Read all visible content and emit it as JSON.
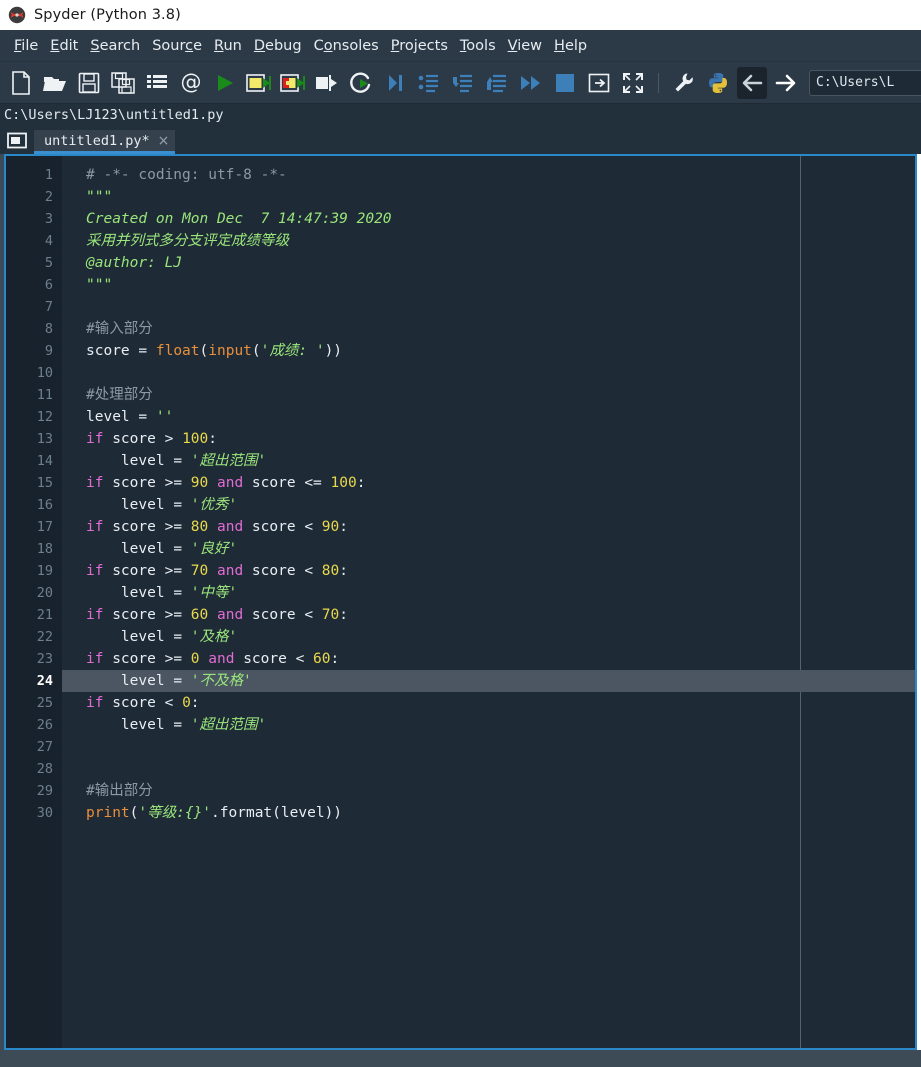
{
  "window": {
    "title": "Spyder (Python 3.8)",
    "app_icon": "spyder-logo-icon"
  },
  "menubar": {
    "items": [
      {
        "label": "File",
        "accel": "F"
      },
      {
        "label": "Edit",
        "accel": "E"
      },
      {
        "label": "Search",
        "accel": "S"
      },
      {
        "label": "Source",
        "accel": "c"
      },
      {
        "label": "Run",
        "accel": "R"
      },
      {
        "label": "Debug",
        "accel": "D"
      },
      {
        "label": "Consoles",
        "accel": "o"
      },
      {
        "label": "Projects",
        "accel": "P"
      },
      {
        "label": "Tools",
        "accel": "T"
      },
      {
        "label": "View",
        "accel": "V"
      },
      {
        "label": "Help",
        "accel": "H"
      }
    ]
  },
  "toolbar": {
    "buttons": [
      {
        "name": "new-file-icon",
        "tip": "New file"
      },
      {
        "name": "open-file-icon",
        "tip": "Open file"
      },
      {
        "name": "save-file-icon",
        "tip": "Save file"
      },
      {
        "name": "save-all-icon",
        "tip": "Save all"
      },
      {
        "name": "file-switcher-icon",
        "tip": "File switcher"
      },
      {
        "name": "symbol-finder-icon",
        "tip": "Symbol finder"
      },
      {
        "name": "run-file-icon",
        "tip": "Run file"
      },
      {
        "name": "run-cell-icon",
        "tip": "Run current cell"
      },
      {
        "name": "run-cell-advance-icon",
        "tip": "Run current cell and go to the next one"
      },
      {
        "name": "run-selection-icon",
        "tip": "Run selection or current line"
      },
      {
        "name": "rerun-last-cell-icon",
        "tip": "Re-run last cell"
      },
      {
        "name": "debug-file-icon",
        "tip": "Debug file"
      },
      {
        "name": "debug-step-over-icon",
        "tip": "Run current line"
      },
      {
        "name": "debug-step-into-icon",
        "tip": "Step into function"
      },
      {
        "name": "debug-step-return-icon",
        "tip": "Run until function returns"
      },
      {
        "name": "debug-continue-icon",
        "tip": "Continue execution"
      },
      {
        "name": "debug-stop-icon",
        "tip": "Stop debugging"
      },
      {
        "name": "maximize-pane-icon",
        "tip": "Maximize current pane"
      },
      {
        "name": "fullscreen-icon",
        "tip": "Fullscreen mode"
      },
      {
        "name": "preferences-icon",
        "tip": "Preferences"
      },
      {
        "name": "pythonpath-manager-icon",
        "tip": "PYTHONPATH manager"
      },
      {
        "name": "back-icon",
        "tip": "Back",
        "active": true
      },
      {
        "name": "forward-icon",
        "tip": "Forward"
      }
    ],
    "path_combo_value": "C:\\Users\\L"
  },
  "pathbar": {
    "path": "C:\\Users\\LJ123\\untitled1.py"
  },
  "tabbar": {
    "browse_icon": "browse-tabs-icon",
    "tabs": [
      {
        "label": "untitled1.py*",
        "close": "×",
        "active": true
      }
    ]
  },
  "editor": {
    "current_line": 24,
    "line_numbers": [
      1,
      2,
      3,
      4,
      5,
      6,
      7,
      8,
      9,
      10,
      11,
      12,
      13,
      14,
      15,
      16,
      17,
      18,
      19,
      20,
      21,
      22,
      23,
      24,
      25,
      26,
      27,
      28,
      29,
      30
    ],
    "lines": [
      {
        "n": 1,
        "tokens": [
          {
            "t": "com",
            "s": "# -*- coding: utf-8 -*-"
          }
        ]
      },
      {
        "n": 2,
        "tokens": [
          {
            "t": "doc",
            "s": "\"\"\""
          }
        ]
      },
      {
        "n": 3,
        "tokens": [
          {
            "t": "doc",
            "s": "Created on Mon Dec  7 14:47:39 2020"
          }
        ]
      },
      {
        "n": 4,
        "tokens": [
          {
            "t": "doc",
            "s": "采用并列式多分支评定成绩等级"
          }
        ]
      },
      {
        "n": 5,
        "tokens": [
          {
            "t": "doc",
            "s": "@author: LJ"
          }
        ]
      },
      {
        "n": 6,
        "tokens": [
          {
            "t": "doc",
            "s": "\"\"\""
          }
        ]
      },
      {
        "n": 7,
        "tokens": []
      },
      {
        "n": 8,
        "tokens": [
          {
            "t": "com",
            "s": "#输入部分"
          }
        ]
      },
      {
        "n": 9,
        "tokens": [
          {
            "t": "def",
            "s": "score "
          },
          {
            "t": "op",
            "s": "= "
          },
          {
            "t": "bi",
            "s": "float"
          },
          {
            "t": "op",
            "s": "("
          },
          {
            "t": "bi",
            "s": "input"
          },
          {
            "t": "op",
            "s": "("
          },
          {
            "t": "str",
            "s": "'成绩: '"
          },
          {
            "t": "op",
            "s": "))"
          }
        ]
      },
      {
        "n": 10,
        "tokens": []
      },
      {
        "n": 11,
        "tokens": [
          {
            "t": "com",
            "s": "#处理部分"
          }
        ]
      },
      {
        "n": 12,
        "tokens": [
          {
            "t": "def",
            "s": "level "
          },
          {
            "t": "op",
            "s": "= "
          },
          {
            "t": "str",
            "s": "''"
          }
        ]
      },
      {
        "n": 13,
        "tokens": [
          {
            "t": "kw",
            "s": "if "
          },
          {
            "t": "def",
            "s": "score "
          },
          {
            "t": "op",
            "s": "> "
          },
          {
            "t": "num",
            "s": "100"
          },
          {
            "t": "op",
            "s": ":"
          }
        ]
      },
      {
        "n": 14,
        "tokens": [
          {
            "t": "def",
            "s": "    level "
          },
          {
            "t": "op",
            "s": "= "
          },
          {
            "t": "str",
            "s": "'超出范围'"
          }
        ]
      },
      {
        "n": 15,
        "tokens": [
          {
            "t": "kw",
            "s": "if "
          },
          {
            "t": "def",
            "s": "score "
          },
          {
            "t": "op",
            "s": ">= "
          },
          {
            "t": "num",
            "s": "90 "
          },
          {
            "t": "kw",
            "s": "and "
          },
          {
            "t": "def",
            "s": "score "
          },
          {
            "t": "op",
            "s": "<= "
          },
          {
            "t": "num",
            "s": "100"
          },
          {
            "t": "op",
            "s": ":"
          }
        ]
      },
      {
        "n": 16,
        "tokens": [
          {
            "t": "def",
            "s": "    level "
          },
          {
            "t": "op",
            "s": "= "
          },
          {
            "t": "str",
            "s": "'优秀'"
          }
        ]
      },
      {
        "n": 17,
        "tokens": [
          {
            "t": "kw",
            "s": "if "
          },
          {
            "t": "def",
            "s": "score "
          },
          {
            "t": "op",
            "s": ">= "
          },
          {
            "t": "num",
            "s": "80 "
          },
          {
            "t": "kw",
            "s": "and "
          },
          {
            "t": "def",
            "s": "score "
          },
          {
            "t": "op",
            "s": "< "
          },
          {
            "t": "num",
            "s": "90"
          },
          {
            "t": "op",
            "s": ":"
          }
        ]
      },
      {
        "n": 18,
        "tokens": [
          {
            "t": "def",
            "s": "    level "
          },
          {
            "t": "op",
            "s": "= "
          },
          {
            "t": "str",
            "s": "'良好'"
          }
        ]
      },
      {
        "n": 19,
        "tokens": [
          {
            "t": "kw",
            "s": "if "
          },
          {
            "t": "def",
            "s": "score "
          },
          {
            "t": "op",
            "s": ">= "
          },
          {
            "t": "num",
            "s": "70 "
          },
          {
            "t": "kw",
            "s": "and "
          },
          {
            "t": "def",
            "s": "score "
          },
          {
            "t": "op",
            "s": "< "
          },
          {
            "t": "num",
            "s": "80"
          },
          {
            "t": "op",
            "s": ":"
          }
        ]
      },
      {
        "n": 20,
        "tokens": [
          {
            "t": "def",
            "s": "    level "
          },
          {
            "t": "op",
            "s": "= "
          },
          {
            "t": "str",
            "s": "'中等'"
          }
        ]
      },
      {
        "n": 21,
        "tokens": [
          {
            "t": "kw",
            "s": "if "
          },
          {
            "t": "def",
            "s": "score "
          },
          {
            "t": "op",
            "s": ">= "
          },
          {
            "t": "num",
            "s": "60 "
          },
          {
            "t": "kw",
            "s": "and "
          },
          {
            "t": "def",
            "s": "score "
          },
          {
            "t": "op",
            "s": "< "
          },
          {
            "t": "num",
            "s": "70"
          },
          {
            "t": "op",
            "s": ":"
          }
        ]
      },
      {
        "n": 22,
        "tokens": [
          {
            "t": "def",
            "s": "    level "
          },
          {
            "t": "op",
            "s": "= "
          },
          {
            "t": "str",
            "s": "'及格'"
          }
        ]
      },
      {
        "n": 23,
        "tokens": [
          {
            "t": "kw",
            "s": "if "
          },
          {
            "t": "def",
            "s": "score "
          },
          {
            "t": "op",
            "s": ">= "
          },
          {
            "t": "num",
            "s": "0 "
          },
          {
            "t": "kw",
            "s": "and "
          },
          {
            "t": "def",
            "s": "score "
          },
          {
            "t": "op",
            "s": "< "
          },
          {
            "t": "num",
            "s": "60"
          },
          {
            "t": "op",
            "s": ":"
          }
        ]
      },
      {
        "n": 24,
        "current": true,
        "tokens": [
          {
            "t": "def",
            "s": "    level "
          },
          {
            "t": "op",
            "s": "= "
          },
          {
            "t": "str",
            "s": "'不及格'"
          }
        ]
      },
      {
        "n": 25,
        "tokens": [
          {
            "t": "kw",
            "s": "if "
          },
          {
            "t": "def",
            "s": "score "
          },
          {
            "t": "op",
            "s": "< "
          },
          {
            "t": "num",
            "s": "0"
          },
          {
            "t": "op",
            "s": ":"
          }
        ]
      },
      {
        "n": 26,
        "tokens": [
          {
            "t": "def",
            "s": "    level "
          },
          {
            "t": "op",
            "s": "= "
          },
          {
            "t": "str",
            "s": "'超出范围'"
          }
        ]
      },
      {
        "n": 27,
        "tokens": []
      },
      {
        "n": 28,
        "tokens": []
      },
      {
        "n": 29,
        "tokens": [
          {
            "t": "com",
            "s": "#输出部分"
          }
        ]
      },
      {
        "n": 30,
        "tokens": [
          {
            "t": "bi",
            "s": "print"
          },
          {
            "t": "op",
            "s": "("
          },
          {
            "t": "str",
            "s": "'等级:{}'"
          },
          {
            "t": "op",
            "s": "."
          },
          {
            "t": "def",
            "s": "format"
          },
          {
            "t": "op",
            "s": "("
          },
          {
            "t": "def",
            "s": "level"
          },
          {
            "t": "op",
            "s": "))"
          }
        ]
      }
    ]
  },
  "colors": {
    "accent": "#2a88c8",
    "menubar_bg": "#2c3a47",
    "editor_bg": "#1e2a36",
    "gutter_bg": "#18222c",
    "current_line_bg": "#4b5662",
    "string": "#9ae67b",
    "keyword": "#e06cd4",
    "number": "#e9d94d",
    "builtin": "#e88f3d",
    "comment": "#8b9aa6"
  }
}
